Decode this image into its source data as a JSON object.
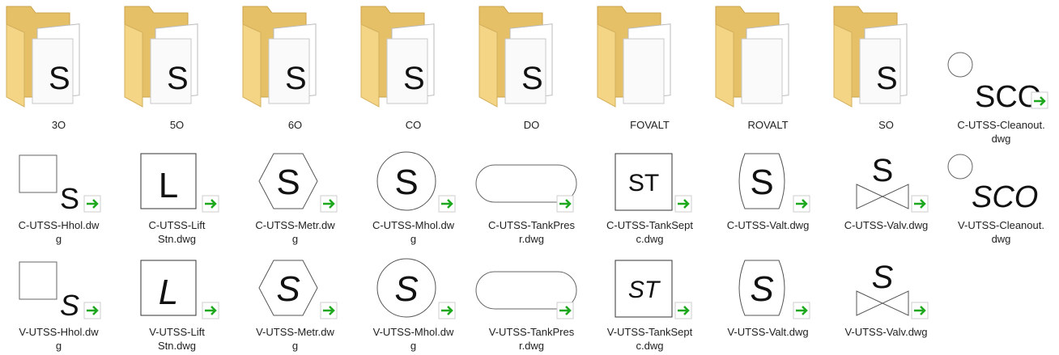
{
  "folders": [
    {
      "name": "3O",
      "glyph": "S"
    },
    {
      "name": "5O",
      "glyph": "S"
    },
    {
      "name": "6O",
      "glyph": "S"
    },
    {
      "name": "CO",
      "glyph": "S"
    },
    {
      "name": "DO",
      "glyph": "S"
    },
    {
      "name": "FOVALT",
      "glyph": ""
    },
    {
      "name": "ROVALT",
      "glyph": ""
    },
    {
      "name": "SO",
      "glyph": "S"
    }
  ],
  "files_row1": [
    {
      "name": "C-UTSS-Cleanout.",
      "name2": "dwg",
      "symbol": "SCO"
    }
  ],
  "files_row2": [
    {
      "name": "C-UTSS-Hhol.dw",
      "name2": "g",
      "symbol": "S"
    },
    {
      "name": "C-UTSS-Lift",
      "name2": "Stn.dwg",
      "symbol": "L"
    },
    {
      "name": "C-UTSS-Metr.dw",
      "name2": "g",
      "symbol": "S"
    },
    {
      "name": "C-UTSS-Mhol.dw",
      "name2": "g",
      "symbol": "S"
    },
    {
      "name": "C-UTSS-TankPres",
      "name2": "r.dwg",
      "symbol": ""
    },
    {
      "name": "C-UTSS-TankSept",
      "name2": "c.dwg",
      "symbol": "ST"
    },
    {
      "name": "C-UTSS-Valt.dwg",
      "name2": "",
      "symbol": "S"
    },
    {
      "name": "C-UTSS-Valv.dwg",
      "name2": "",
      "symbol": "S"
    },
    {
      "name": "V-UTSS-Cleanout.",
      "name2": "dwg",
      "symbol": "SCO"
    }
  ],
  "files_row3": [
    {
      "name": "V-UTSS-Hhol.dw",
      "name2": "g",
      "symbol": "S"
    },
    {
      "name": "V-UTSS-Lift",
      "name2": "Stn.dwg",
      "symbol": "L"
    },
    {
      "name": "V-UTSS-Metr.dw",
      "name2": "g",
      "symbol": "S"
    },
    {
      "name": "V-UTSS-Mhol.dw",
      "name2": "g",
      "symbol": "S"
    },
    {
      "name": "V-UTSS-TankPres",
      "name2": "r.dwg",
      "symbol": ""
    },
    {
      "name": "V-UTSS-TankSept",
      "name2": "c.dwg",
      "symbol": "ST"
    },
    {
      "name": "V-UTSS-Valt.dwg",
      "name2": "",
      "symbol": "S"
    },
    {
      "name": "V-UTSS-Valv.dwg",
      "name2": "",
      "symbol": "S"
    }
  ],
  "colors": {
    "folder_back": "#e9c46a",
    "folder_front": "#f6dc8d",
    "shortcut_arrow": "#1ea81e"
  }
}
